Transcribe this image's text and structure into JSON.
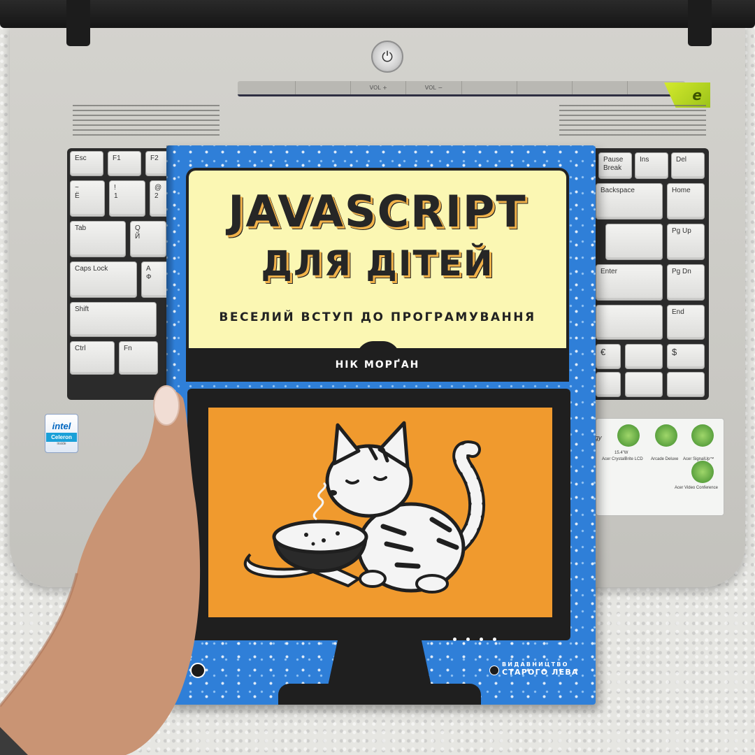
{
  "laptop": {
    "media_buttons": [
      "",
      "",
      "VOL +",
      "VOL −",
      "",
      "",
      "",
      ""
    ],
    "acer_button_glyph": "e",
    "keys": {
      "esc": "Esc",
      "f1": "F1",
      "f2": "F2",
      "tilde": "~\n  Ё",
      "one": "!\n  1",
      "two": "@\n  2",
      "tab": "Tab",
      "q": "Q\n  Й",
      "caps": "Caps Lock",
      "a": "A\n  Ф",
      "shift": "Shift",
      "ctrl": "Ctrl",
      "fn": "Fn",
      "pause": "Pause\nBreak",
      "ins": "Ins",
      "del": "Del",
      "backspace": "Backspace",
      "home": "Home",
      "pgup": "Pg Up",
      "enter": "Enter",
      "pgdn": "Pg Dn",
      "end": "End",
      "euro": "€",
      "dollar": "$"
    },
    "intel": {
      "brand": "intel",
      "product": "Celeron",
      "note": "inside"
    },
    "sticker": {
      "lcd": "Acer CrystalBrite LCD",
      "lcd_size": "15.4\"W",
      "arcade": "Arcade Deluxe",
      "signup": "Acer SignalUp™",
      "video": "Acer Video Conference",
      "partial_word": "gy"
    },
    "colors": {
      "body": "#cac9c4",
      "keyboard_gap": "#2b2b2b",
      "acer_green": "#b4d424"
    }
  },
  "book": {
    "title_line1": "JAVASCRIPT",
    "title_line2": "ДЛЯ ДІТЕЙ",
    "subtitle": "ВЕСЕЛИЙ ВСТУП ДО ПРОГРАМУВАННЯ",
    "author": "НІК МОРҐАН",
    "publisher_line1": "ВИДАВНИЦТВО",
    "publisher_line2": "СТАРОГО ЛЕВА",
    "illustration": "cat-eating-soup-illustration",
    "colors": {
      "cover_blue": "#2f7fd8",
      "title_panel": "#fbf7b3",
      "title_shadow": "#f1b24a",
      "screen_orange": "#f09a2e",
      "frame_black": "#1f1f1f"
    }
  }
}
